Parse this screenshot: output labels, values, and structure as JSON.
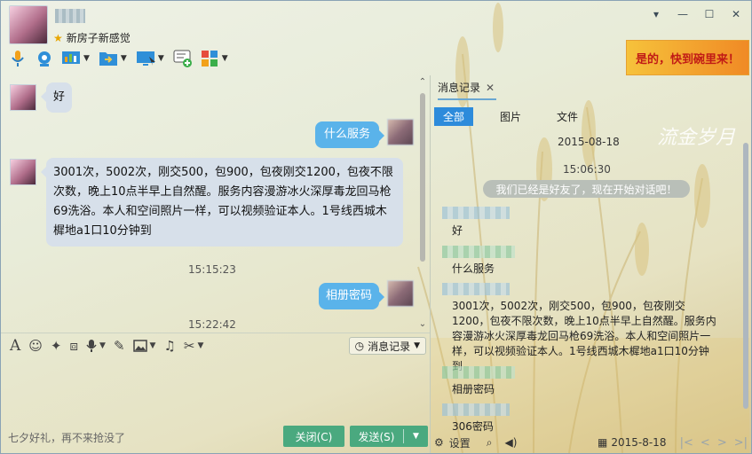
{
  "header": {
    "signature": "新房子新感觉",
    "ad_text": "是的，快到碗里来！"
  },
  "window_controls": [
    "chevron-down-icon",
    "minimize-icon",
    "maximize-icon",
    "close-icon"
  ],
  "toolbar": [
    "microphone-icon",
    "video-camera-icon",
    "screen-share-icon",
    "file-transfer-icon",
    "remote-desktop-icon",
    "add-chat-icon",
    "apps-icon"
  ],
  "chat": {
    "messages": [
      {
        "side": "left",
        "text": "好"
      },
      {
        "side": "right",
        "text": "什么服务"
      },
      {
        "side": "left",
        "text": "3001次，5002次，刚交500，包900，包夜刚交1200，包夜不限次数，晚上10点半早上自然醒。服务内容漫游冰火深厚毒龙回马枪69洗浴。本人和空间照片一样，可以视频验证本人。1号线西城木樨地a1口10分钟到"
      },
      {
        "side": "right",
        "text": "相册密码"
      }
    ],
    "times": [
      "15:15:23",
      "15:22:42"
    ]
  },
  "input_toolbar": {
    "icons": [
      "font-icon",
      "emoji-icon",
      "shake-icon",
      "screenshot-icon",
      "voice-icon",
      "edit-icon",
      "image-icon",
      "music-icon",
      "scissors-icon"
    ],
    "history_label": "消息记录"
  },
  "footer": {
    "promo": "七夕好礼，再不来抢没了",
    "close_label": "关闭(C)",
    "send_label": "发送(S)"
  },
  "history": {
    "tab_title": "消息记录",
    "filters": [
      "全部",
      "图片",
      "文件"
    ],
    "date": "2015-08-18",
    "watermark": "流金岁月",
    "time": "15:06:30",
    "notice": "我们已经是好友了，现在开始对话吧！",
    "entries": [
      "好",
      "什么服务",
      "3001次，5002次，刚交500，包900，包夜刚交1200，包夜不限次数，晚上10点半早上自然醒。服务内容漫游冰火深厚毒龙回马枪69洗浴。本人和空间照片一样，可以视频验证本人。1号线西城木樨地a1口10分钟到",
      "相册密码",
      "306密码"
    ],
    "footer": {
      "settings_label": "设置",
      "date_label": "2015-8-18"
    }
  }
}
